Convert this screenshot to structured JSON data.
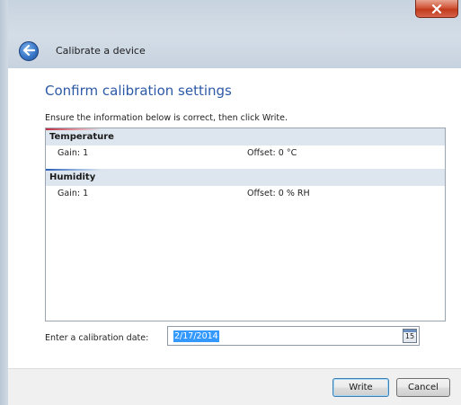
{
  "window": {
    "nav_title": "Calibrate a device"
  },
  "page": {
    "heading": "Confirm calibration settings",
    "instruction": "Ensure the information below is correct, then click Write."
  },
  "settings": {
    "groups": [
      {
        "name": "Temperature",
        "gain": "Gain: 1",
        "offset": "Offset: 0  °C",
        "accent": "#c12c3e"
      },
      {
        "name": "Humidity",
        "gain": "Gain: 1",
        "offset": "Offset: 0  % RH",
        "accent": "#2a5fb6"
      }
    ]
  },
  "date": {
    "label": "Enter a calibration date:",
    "value": "2/17/2014",
    "calendar_day": "15"
  },
  "buttons": {
    "write_label": "Write",
    "cancel_label": "Cancel"
  },
  "icons": {
    "close": "close-icon",
    "back": "back-arrow-icon",
    "calendar": "calendar-icon"
  }
}
